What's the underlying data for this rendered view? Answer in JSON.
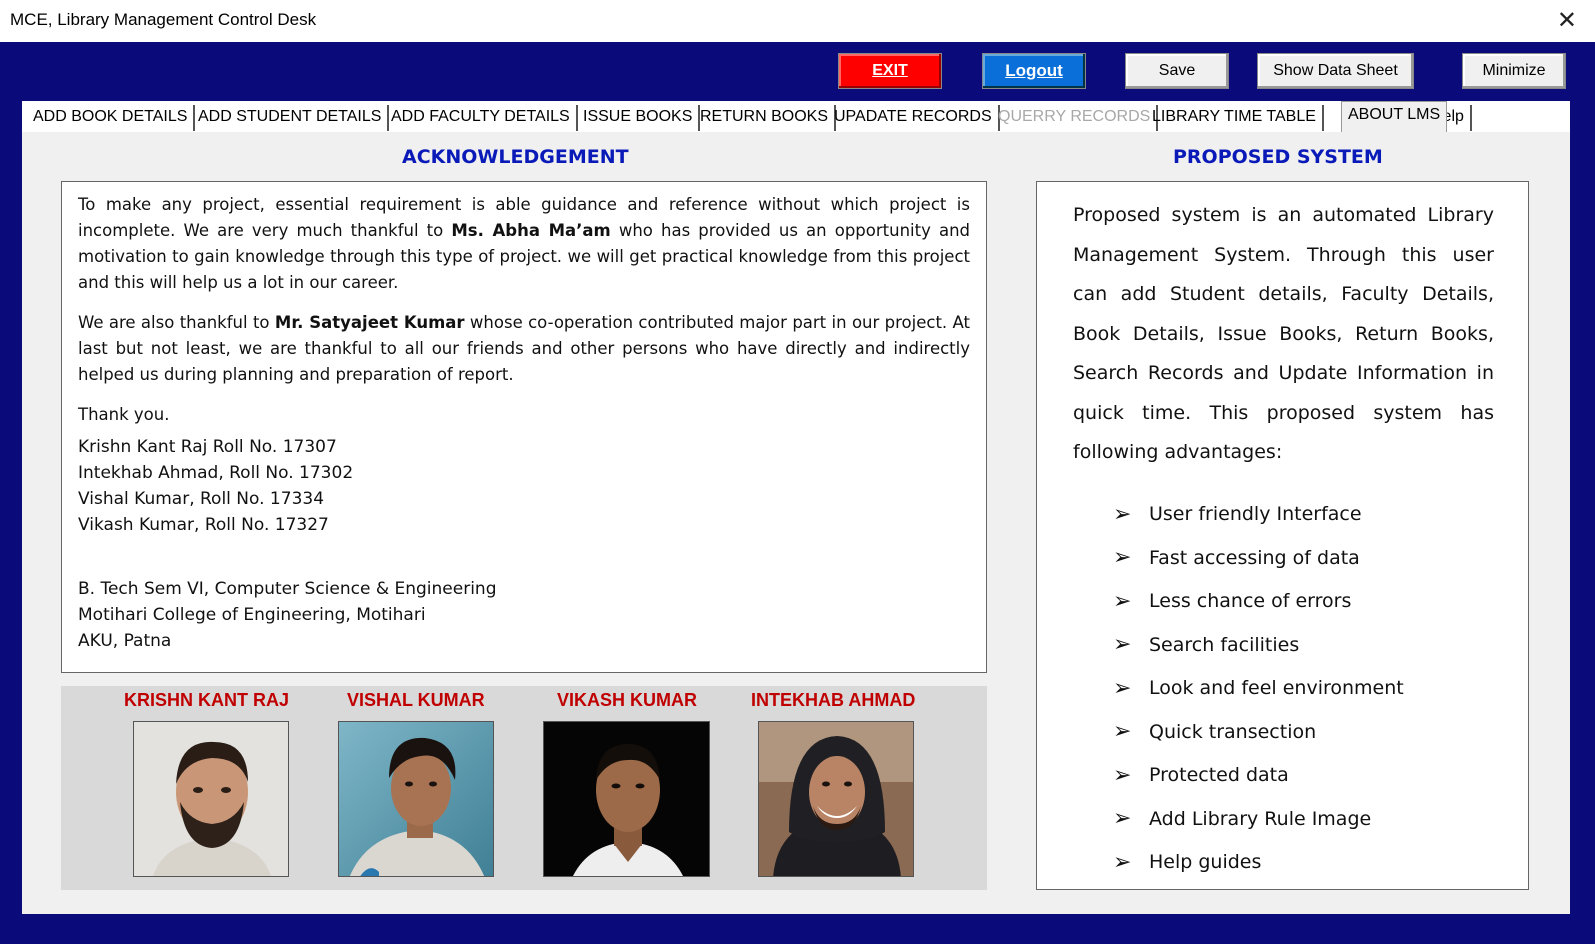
{
  "window": {
    "title": "MCE, Library Management Control Desk",
    "close_glyph": "✕"
  },
  "toolbar": {
    "exit_label": "EXIT",
    "logout_label": "Logout",
    "save_label": "Save",
    "show_data_sheet_label": "Show Data Sheet",
    "minimize_label": "Minimize"
  },
  "tabs": [
    {
      "label": "ADD BOOK DETAILS"
    },
    {
      "label": "ADD STUDENT DETAILS"
    },
    {
      "label": "ADD FACULTY DETAILS"
    },
    {
      "label": "ISSUE BOOKS"
    },
    {
      "label": "RETURN BOOKS"
    },
    {
      "label": "UPADATE RECORDS"
    },
    {
      "label": "QUERRY RECORDS",
      "disabled": true
    },
    {
      "label": "LIBRARY TIME TABLE"
    },
    {
      "label": "ABOUT LMS",
      "active": true
    },
    {
      "label": "Help"
    }
  ],
  "acknowledgement": {
    "heading": "ACKNOWLEDGEMENT",
    "p1_a": "To make any project, essential requirement is able guidance and reference without which project is incomplete. We are very much thankful to ",
    "p1_bold": "Ms. Abha Ma’am",
    "p1_b": " who has provided us an opportunity and motivation to gain knowledge through this type of project. we will get practical knowledge from this project and this will help us a lot in our career.",
    "p2_a": "We are also thankful to ",
    "p2_bold": "Mr. Satyajeet Kumar",
    "p2_b": " whose co-operation contributed major part in our project. At last but not least, we are thankful to all our friends and other persons who have directly and indirectly helped us during planning and preparation of report.",
    "thanks": "Thank you.",
    "names": [
      "Krishn Kant Raj Roll No. 17307",
      "Intekhab Ahmad, Roll No. 17302",
      "Vishal Kumar, Roll No. 17334",
      "Vikash Kumar, Roll No. 17327"
    ],
    "college": [
      "B. Tech Sem VI, Computer Science & Engineering",
      "Motihari College of Engineering, Motihari",
      "AKU, Patna"
    ]
  },
  "team": [
    {
      "name": "KRISHN KANT RAJ"
    },
    {
      "name": "VISHAL KUMAR"
    },
    {
      "name": "VIKASH KUMAR"
    },
    {
      "name": "INTEKHAB AHMAD"
    }
  ],
  "proposed": {
    "heading": "PROPOSED SYSTEM",
    "intro": "Proposed system is an automated Library Management System. Through this user can add Student details, Faculty Details, Book Details, Issue Books, Return Books, Search Records and Update Information in quick time. This proposed system has following advantages:",
    "bullet_glyph": "➢",
    "advantages": [
      "User friendly Interface",
      "Fast accessing of data",
      "Less chance of errors",
      "Search facilities",
      "Look and feel environment",
      "Quick transection",
      "Protected data",
      "Add Library Rule Image",
      "Help guides"
    ]
  },
  "colors": {
    "frame_bg": "#0a0a7a",
    "heading_blue": "#0a1ab8",
    "name_red": "#c00000",
    "exit_red": "#ff0000",
    "logout_blue": "#0a6fd8"
  }
}
